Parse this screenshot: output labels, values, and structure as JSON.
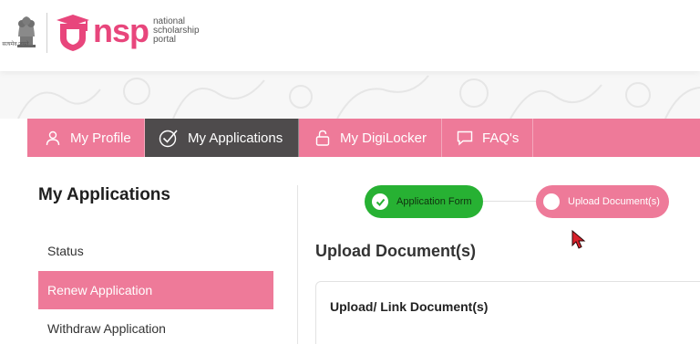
{
  "header": {
    "emblem_caption": "सत्यमेव जयते",
    "logo_text": "nsp",
    "logo_subtitle": [
      "national",
      "scholarship",
      "portal"
    ]
  },
  "nav": {
    "items": [
      {
        "label": "My Profile",
        "icon": "user-icon",
        "active": false
      },
      {
        "label": "My Applications",
        "icon": "check-circle-icon",
        "active": true
      },
      {
        "label": "My DigiLocker",
        "icon": "lock-icon",
        "active": false
      },
      {
        "label": "FAQ's",
        "icon": "chat-icon",
        "active": false
      }
    ]
  },
  "sidebar": {
    "title": "My Applications",
    "items": [
      {
        "label": "Status",
        "active": false
      },
      {
        "label": "Renew Application",
        "active": true
      },
      {
        "label": "Withdraw Application",
        "active": false
      }
    ]
  },
  "stepper": {
    "steps": [
      {
        "label": "Application Form",
        "state": "done"
      },
      {
        "label": "Upload Document(s)",
        "state": "current"
      }
    ]
  },
  "main": {
    "title": "Upload Document(s)",
    "card_title": "Upload/ Link Document(s)"
  },
  "colors": {
    "accent": "#ee7a99",
    "nav_active": "#4e4b4c",
    "logo_pink": "#e8467c",
    "step_done": "#27b133"
  }
}
